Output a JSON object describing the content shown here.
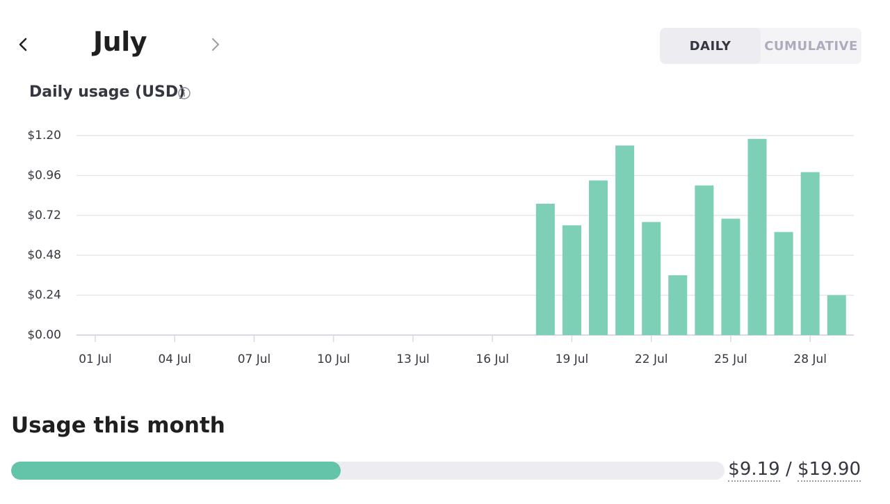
{
  "header": {
    "month": "July",
    "prev_icon": "chevron-left-icon",
    "next_icon": "chevron-right-icon"
  },
  "toggle": {
    "daily_label": "DAILY",
    "cumulative_label": "CUMULATIVE",
    "active": "daily"
  },
  "chart_title": "Daily usage (USD)",
  "chart_data": {
    "type": "bar",
    "title": "Daily usage (USD)",
    "xlabel": "",
    "ylabel": "",
    "ylim": [
      0,
      1.2
    ],
    "yticks": [
      "$0.00",
      "$0.24",
      "$0.48",
      "$0.72",
      "$0.96",
      "$1.20"
    ],
    "xtick_labels": [
      "01 Jul",
      "04 Jul",
      "07 Jul",
      "10 Jul",
      "13 Jul",
      "16 Jul",
      "19 Jul",
      "22 Jul",
      "25 Jul",
      "28 Jul"
    ],
    "categories": [
      "01 Jul",
      "02 Jul",
      "03 Jul",
      "04 Jul",
      "05 Jul",
      "06 Jul",
      "07 Jul",
      "08 Jul",
      "09 Jul",
      "10 Jul",
      "11 Jul",
      "12 Jul",
      "13 Jul",
      "14 Jul",
      "15 Jul",
      "16 Jul",
      "17 Jul",
      "18 Jul",
      "19 Jul",
      "20 Jul",
      "21 Jul",
      "22 Jul",
      "23 Jul",
      "24 Jul",
      "25 Jul",
      "26 Jul",
      "27 Jul",
      "28 Jul",
      "29 Jul"
    ],
    "values": [
      0,
      0,
      0,
      0,
      0,
      0,
      0,
      0,
      0,
      0,
      0,
      0,
      0,
      0,
      0,
      0,
      0,
      0.79,
      0.66,
      0.93,
      1.14,
      0.68,
      0.36,
      0.9,
      0.7,
      1.18,
      0.62,
      0.98,
      0.24
    ],
    "bar_color": "#7dcfb6",
    "grid": true
  },
  "usage": {
    "title": "Usage this month",
    "used": "$9.19",
    "separator": "/",
    "limit": "$19.90",
    "fraction": 0.462,
    "fill_color": "#64c4aa"
  }
}
